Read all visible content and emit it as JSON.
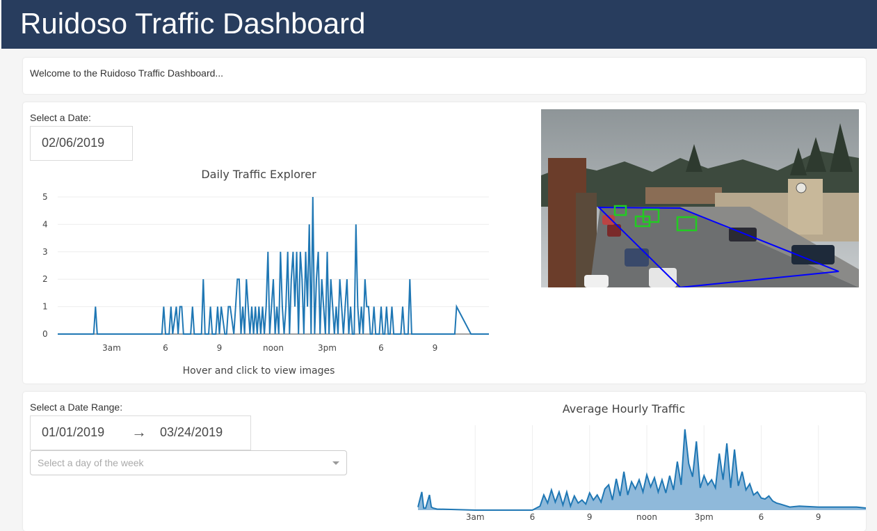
{
  "header": {
    "title": "Ruidoso Traffic Dashboard"
  },
  "welcome": {
    "text": "Welcome to the Ruidoso Traffic Dashboard..."
  },
  "daily": {
    "date_label": "Select a Date:",
    "date_value": "02/06/2019",
    "camera_icon": "traffic-camera-image"
  },
  "range": {
    "label": "Select a Date Range:",
    "start": "01/01/2019",
    "arrow": "→",
    "end": "03/24/2019",
    "weekday_placeholder": "Select a day of the week"
  },
  "colors": {
    "header_bg": "#283d5e",
    "line": "#1f77b4",
    "area_fill": "#8fb9da",
    "box_green": "#22cc22",
    "roi_blue": "#0000ff"
  },
  "chart_data": [
    {
      "type": "line",
      "title": "Daily Traffic Explorer",
      "xlabel": "Hover and click to view images",
      "ylabel": "",
      "x_unit": "hour of day",
      "xlim": [
        0,
        24
      ],
      "ylim": [
        0,
        5
      ],
      "yticks": [
        "0",
        "1",
        "2",
        "3",
        "4",
        "5"
      ],
      "xticks": [
        {
          "v": 3,
          "label": "3am"
        },
        {
          "v": 6,
          "label": "6"
        },
        {
          "v": 9,
          "label": "9"
        },
        {
          "v": 12,
          "label": "noon"
        },
        {
          "v": 15,
          "label": "3pm"
        },
        {
          "v": 18,
          "label": "6"
        },
        {
          "v": 21,
          "label": "9"
        }
      ],
      "grid": "horizontal",
      "x": [
        2.0,
        2.1,
        2.2,
        5.8,
        5.9,
        6.0,
        6.2,
        6.3,
        6.4,
        6.6,
        6.7,
        6.8,
        6.9,
        7.0,
        7.1,
        7.4,
        7.5,
        7.6,
        7.7,
        8.0,
        8.1,
        8.2,
        8.4,
        8.5,
        8.6,
        8.8,
        8.9,
        9.0,
        9.1,
        9.3,
        9.4,
        9.5,
        9.6,
        9.8,
        9.9,
        10.0,
        10.1,
        10.2,
        10.3,
        10.4,
        10.5,
        10.6,
        10.7,
        10.8,
        10.9,
        11.0,
        11.1,
        11.2,
        11.3,
        11.4,
        11.5,
        11.6,
        11.7,
        11.8,
        11.9,
        12.0,
        12.1,
        12.2,
        12.3,
        12.4,
        12.5,
        12.6,
        12.7,
        12.8,
        12.9,
        13.0,
        13.1,
        13.2,
        13.3,
        13.4,
        13.5,
        13.6,
        13.7,
        13.8,
        13.9,
        14.0,
        14.1,
        14.2,
        14.3,
        14.4,
        14.5,
        14.6,
        14.7,
        14.8,
        14.9,
        15.0,
        15.1,
        15.2,
        15.3,
        15.4,
        15.5,
        15.6,
        15.7,
        15.8,
        15.9,
        16.0,
        16.1,
        16.2,
        16.3,
        16.4,
        16.5,
        16.6,
        16.7,
        16.8,
        16.9,
        17.0,
        17.1,
        17.2,
        17.3,
        17.4,
        17.5,
        17.6,
        17.7,
        17.8,
        17.9,
        18.0,
        18.1,
        18.2,
        18.3,
        18.4,
        18.5,
        18.6,
        18.7,
        18.8,
        18.9,
        19.0,
        19.1,
        19.2,
        19.3,
        19.4,
        19.5,
        19.6,
        19.7,
        19.8,
        19.9,
        20.0,
        20.1,
        20.2,
        22.0,
        22.1,
        22.2,
        23.0,
        23.1,
        23.2
      ],
      "y": [
        0,
        1,
        0,
        0,
        1,
        0,
        0,
        1,
        0,
        1,
        0,
        1,
        1,
        0,
        0,
        0,
        1,
        0,
        0,
        0,
        2,
        0,
        0,
        1,
        0,
        0,
        1,
        0,
        1,
        0,
        0,
        1,
        1,
        0,
        1,
        2,
        2,
        0,
        1,
        0,
        2,
        1,
        0,
        1,
        0,
        1,
        0,
        1,
        0,
        1,
        0,
        1,
        3,
        0,
        1,
        2,
        0,
        1,
        0,
        3,
        1,
        0,
        1,
        3,
        0,
        2,
        3,
        1,
        3,
        0,
        3,
        2,
        0,
        3,
        1,
        4,
        0,
        5,
        0,
        2,
        3,
        0,
        2,
        1,
        0,
        3,
        0,
        2,
        1,
        0,
        1,
        0,
        2,
        1,
        0,
        1,
        2,
        0,
        1,
        0,
        0,
        4,
        1,
        0,
        1,
        0,
        2,
        1,
        1,
        0,
        0,
        1,
        0,
        0,
        0,
        1,
        0,
        0,
        1,
        0,
        0,
        1,
        0,
        0,
        0,
        0,
        0,
        1,
        0,
        0,
        0,
        2,
        0,
        0,
        0,
        0,
        0,
        0,
        0,
        0,
        1,
        0,
        0,
        0,
        1,
        0
      ],
      "note": "approximate, read from plot"
    },
    {
      "type": "area",
      "title": "Average Hourly Traffic",
      "xlabel": "",
      "ylabel": "",
      "xlim": [
        0,
        24
      ],
      "xticks": [
        {
          "v": 3,
          "label": "3am"
        },
        {
          "v": 6,
          "label": "6"
        },
        {
          "v": 9,
          "label": "9"
        },
        {
          "v": 12,
          "label": "noon"
        },
        {
          "v": 15,
          "label": "3pm"
        },
        {
          "v": 18,
          "label": "6"
        },
        {
          "v": 21,
          "label": "9"
        }
      ],
      "grid": "vertical",
      "x": [
        0.0,
        0.2,
        0.3,
        0.4,
        0.6,
        0.7,
        0.8,
        1.0,
        3.0,
        5.0,
        6.0,
        6.2,
        6.4,
        6.6,
        6.8,
        7.0,
        7.2,
        7.4,
        7.6,
        7.8,
        8.0,
        8.2,
        8.4,
        8.6,
        8.8,
        9.0,
        9.2,
        9.4,
        9.6,
        9.8,
        10.0,
        10.2,
        10.4,
        10.6,
        10.8,
        11.0,
        11.2,
        11.4,
        11.6,
        11.8,
        12.0,
        12.2,
        12.4,
        12.6,
        12.8,
        13.0,
        13.2,
        13.4,
        13.6,
        13.8,
        14.0,
        14.2,
        14.4,
        14.6,
        14.8,
        15.0,
        15.2,
        15.4,
        15.6,
        15.8,
        16.0,
        16.2,
        16.4,
        16.6,
        16.8,
        17.0,
        17.2,
        17.4,
        17.6,
        17.8,
        18.0,
        18.2,
        18.4,
        18.6,
        18.8,
        19.0,
        19.5,
        20.0,
        21.0,
        22.0,
        23.0,
        23.5,
        24.0
      ],
      "y": [
        0.3,
        1.8,
        0.2,
        0.2,
        1.5,
        0.3,
        0.2,
        0.1,
        0.0,
        0.0,
        0.0,
        0.2,
        0.4,
        1.5,
        0.7,
        2.0,
        0.8,
        1.8,
        0.5,
        1.8,
        0.4,
        1.4,
        0.7,
        1.0,
        0.6,
        1.7,
        1.0,
        1.5,
        0.8,
        2.1,
        2.5,
        1.0,
        3.1,
        1.4,
        3.8,
        1.5,
        2.8,
        2.1,
        3.0,
        1.8,
        3.5,
        2.3,
        3.2,
        1.8,
        3.0,
        1.7,
        3.4,
        2.0,
        4.8,
        2.5,
        8.0,
        4.6,
        3.3,
        6.8,
        2.2,
        3.4,
        2.5,
        3.0,
        2.2,
        5.6,
        3.0,
        6.6,
        2.2,
        6.0,
        2.4,
        3.8,
        2.0,
        2.6,
        1.5,
        1.8,
        1.2,
        1.1,
        1.4,
        0.9,
        0.7,
        0.6,
        0.3,
        0.4,
        0.3,
        0.3,
        0.3,
        0.2,
        0.2
      ],
      "note": "approximate, read from plot; y axis not labeled"
    }
  ]
}
